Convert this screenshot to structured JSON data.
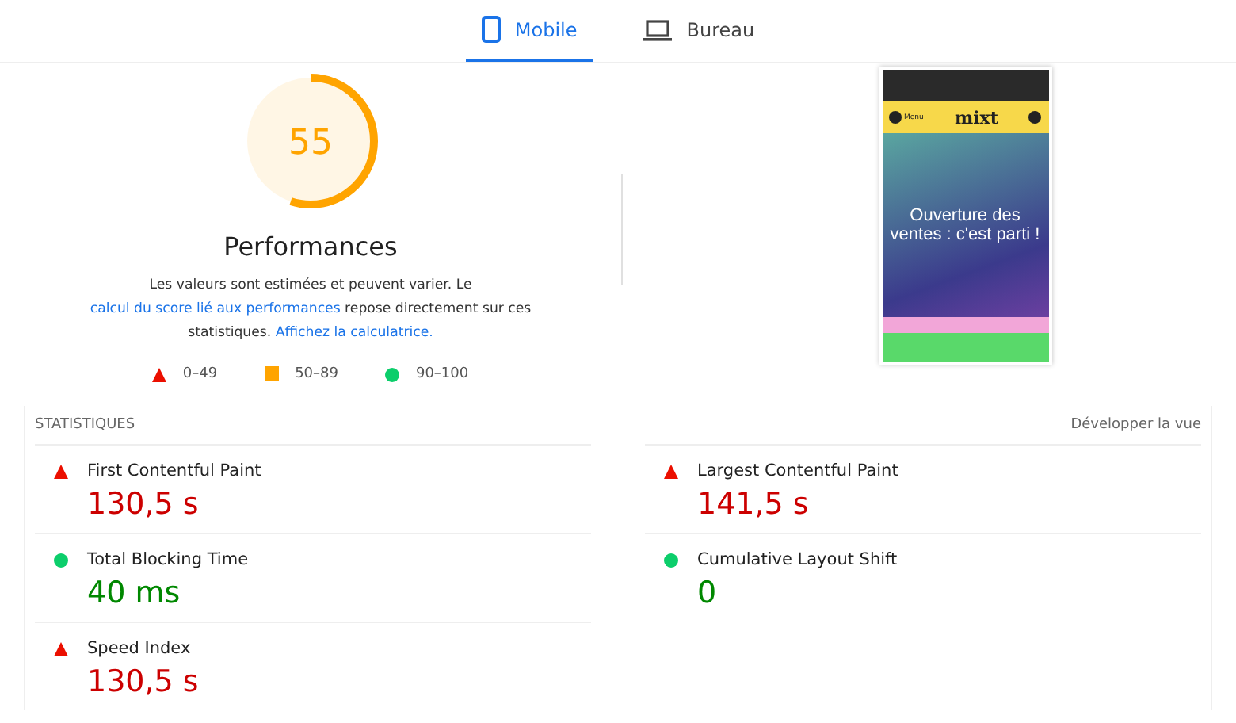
{
  "tabs": [
    {
      "label": "Mobile",
      "kind": "phone",
      "selected": true
    },
    {
      "label": "Bureau",
      "kind": "laptop",
      "selected": false
    }
  ],
  "score": {
    "value": "55",
    "level": 0.55,
    "kind": "average",
    "title": "Performances"
  },
  "description": [
    {
      "kind": "text",
      "text": "Les valeurs sont estimées et peuvent varier. Le "
    },
    {
      "kind": "link",
      "text": "calcul du score lié aux performances"
    },
    {
      "kind": "text",
      "text": " repose directement sur ces statistiques. "
    },
    {
      "kind": "link",
      "text": "Affichez la calculatrice."
    }
  ],
  "legend": [
    {
      "kind": "fail",
      "label": "0–49"
    },
    {
      "kind": "average",
      "label": "50–89"
    },
    {
      "kind": "pass",
      "label": "90–100"
    }
  ],
  "preview": {
    "menu": "Menu",
    "logo": "mixt",
    "headline": "Ouverture des ventes : c'est parti !"
  },
  "metrics_header": {
    "title": "STATISTIQUES",
    "toggle": "Développer la vue"
  },
  "metrics": [
    {
      "name": "First Contentful Paint",
      "value": "130,5 s",
      "kind": "fail"
    },
    {
      "name": "Largest Contentful Paint",
      "value": "141,5 s",
      "kind": "fail"
    },
    {
      "name": "Total Blocking Time",
      "value": "40 ms",
      "kind": "pass"
    },
    {
      "name": "Cumulative Layout Shift",
      "value": "0",
      "kind": "pass"
    },
    {
      "name": "Speed Index",
      "value": "130,5 s",
      "kind": "fail"
    }
  ]
}
